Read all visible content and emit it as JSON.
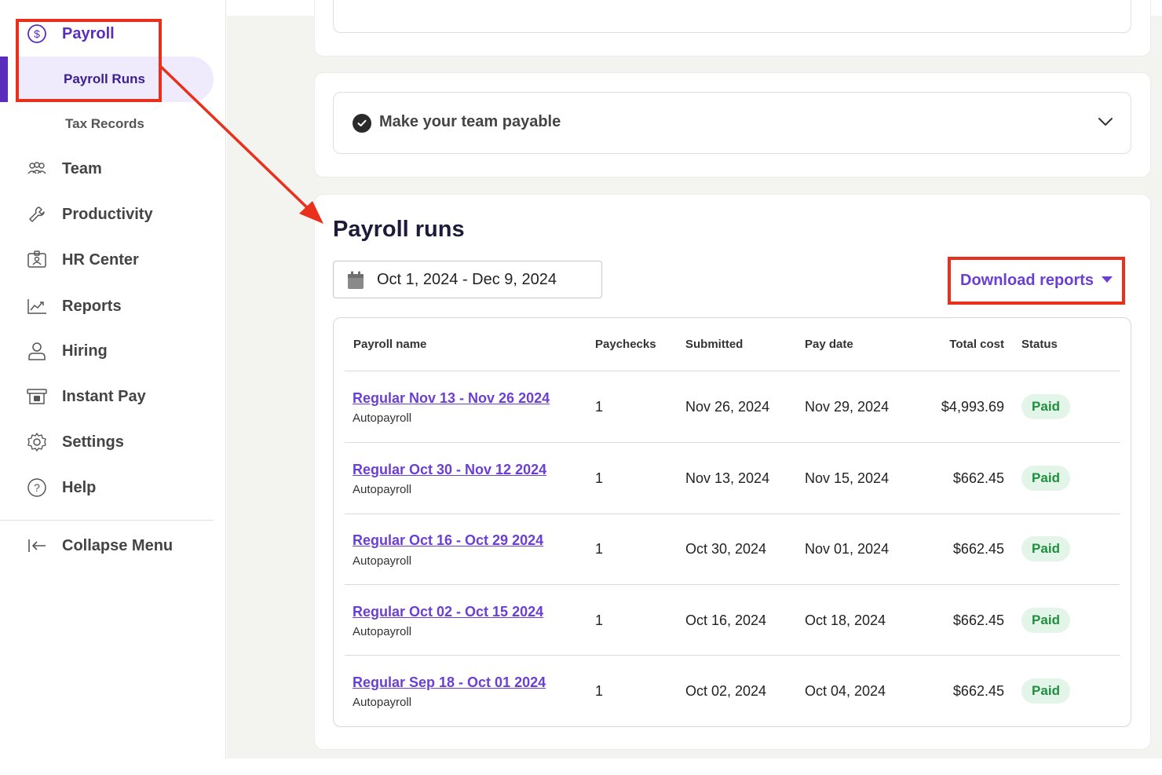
{
  "sidebar": {
    "payroll_label": "Payroll",
    "payroll_runs_label": "Payroll Runs",
    "tax_records_label": "Tax Records",
    "items": [
      {
        "label": "Team",
        "icon": "team-icon"
      },
      {
        "label": "Productivity",
        "icon": "wrench-icon"
      },
      {
        "label": "HR Center",
        "icon": "id-badge-icon"
      },
      {
        "label": "Reports",
        "icon": "chart-icon"
      },
      {
        "label": "Hiring",
        "icon": "person-icon"
      },
      {
        "label": "Instant Pay",
        "icon": "wallet-icon"
      },
      {
        "label": "Settings",
        "icon": "gear-icon"
      },
      {
        "label": "Help",
        "icon": "help-icon"
      }
    ],
    "collapse_label": "Collapse Menu"
  },
  "payable": {
    "label": "Make your team payable"
  },
  "runs": {
    "title": "Payroll runs",
    "date_range": "Oct 1, 2024 - Dec 9, 2024",
    "download_label": "Download reports",
    "columns": [
      "Payroll name",
      "Paychecks",
      "Submitted",
      "Pay date",
      "Total cost",
      "Status"
    ],
    "rows": [
      {
        "name": "Regular Nov 13 - Nov 26 2024",
        "sub": "Autopayroll",
        "paychecks": "1",
        "submitted": "Nov 26, 2024",
        "pay_date": "Nov 29, 2024",
        "total": "$4,993.69",
        "status": "Paid"
      },
      {
        "name": "Regular Oct 30 - Nov 12 2024",
        "sub": "Autopayroll",
        "paychecks": "1",
        "submitted": "Nov 13, 2024",
        "pay_date": "Nov 15, 2024",
        "total": "$662.45",
        "status": "Paid"
      },
      {
        "name": "Regular Oct 16 - Oct 29 2024",
        "sub": "Autopayroll",
        "paychecks": "1",
        "submitted": "Oct 30, 2024",
        "pay_date": "Nov 01, 2024",
        "total": "$662.45",
        "status": "Paid"
      },
      {
        "name": "Regular Oct 02 - Oct 15 2024",
        "sub": "Autopayroll",
        "paychecks": "1",
        "submitted": "Oct 16, 2024",
        "pay_date": "Oct 18, 2024",
        "total": "$662.45",
        "status": "Paid"
      },
      {
        "name": "Regular Sep 18 - Oct 01 2024",
        "sub": "Autopayroll",
        "paychecks": "1",
        "submitted": "Oct 02, 2024",
        "pay_date": "Oct 04, 2024",
        "total": "$662.45",
        "status": "Paid"
      }
    ]
  },
  "colors": {
    "accent": "#6b3fd4",
    "active_nav_bg": "#efeafc",
    "annotation_red": "#e8301c",
    "paid_bg": "#e3f5e8",
    "paid_text": "#1f8f3e"
  }
}
